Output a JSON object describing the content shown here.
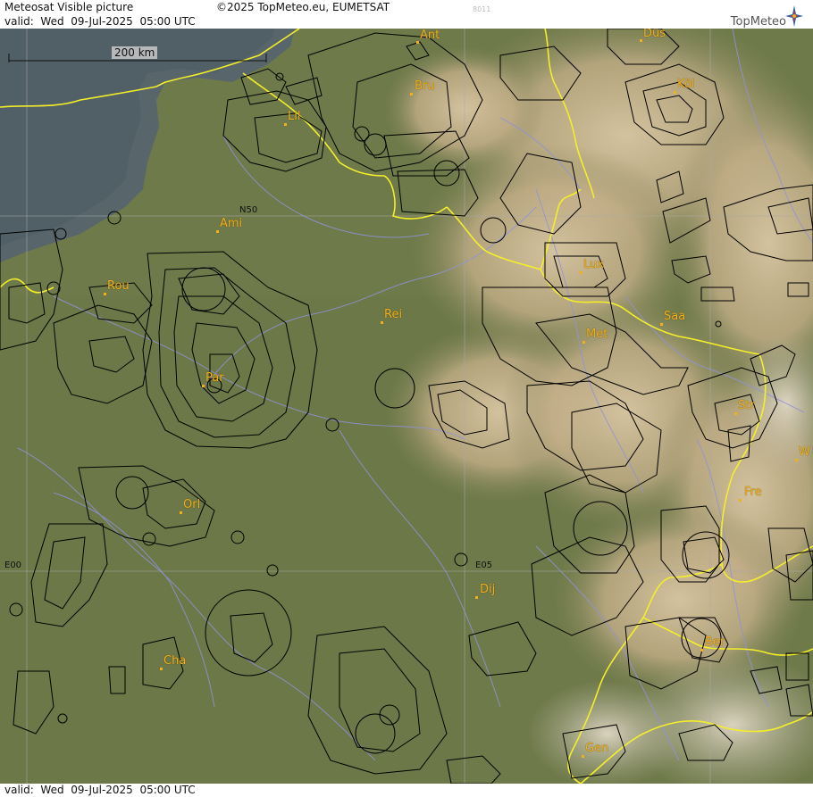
{
  "header": {
    "title": "Meteosat Visible picture",
    "valid": "valid:  Wed  09-Jul-2025  05:00 UTC",
    "copyright": "©2025 TopMeteo.eu, EUMETSAT",
    "code": "8011",
    "brand": "TopMeteo"
  },
  "footer": {
    "valid": "valid:  Wed  09-Jul-2025  05:00 UTC"
  },
  "map": {
    "scale_label": "200 km",
    "grid_labels": {
      "n50": "N50",
      "e00": "E00",
      "e05": "E05"
    },
    "cities": [
      {
        "id": "ant",
        "label": "Ant"
      },
      {
        "id": "dus",
        "label": "Düs"
      },
      {
        "id": "bru",
        "label": "Bru"
      },
      {
        "id": "kol",
        "label": "Köl"
      },
      {
        "id": "lil",
        "label": "Lil"
      },
      {
        "id": "ami",
        "label": "Ami"
      },
      {
        "id": "lux",
        "label": "Lux"
      },
      {
        "id": "rou",
        "label": "Rou"
      },
      {
        "id": "rei",
        "label": "Rei"
      },
      {
        "id": "saa",
        "label": "Saa"
      },
      {
        "id": "met",
        "label": "Met"
      },
      {
        "id": "par",
        "label": "Par"
      },
      {
        "id": "str",
        "label": "Str"
      },
      {
        "id": "w",
        "label": "W"
      },
      {
        "id": "fre",
        "label": "Fre"
      },
      {
        "id": "orl",
        "label": "Orl"
      },
      {
        "id": "dij",
        "label": "Dij"
      },
      {
        "id": "ber",
        "label": "Ber"
      },
      {
        "id": "cha",
        "label": "Cha"
      },
      {
        "id": "gen",
        "label": "Gen"
      }
    ],
    "colors": {
      "land": "#6f7a4a",
      "sea": "#56646a",
      "clouds": "#c9b48f",
      "border": "#f4ee2a",
      "river": "#8f93d8",
      "airspace": "#000000",
      "city": "#f2b01e"
    }
  }
}
